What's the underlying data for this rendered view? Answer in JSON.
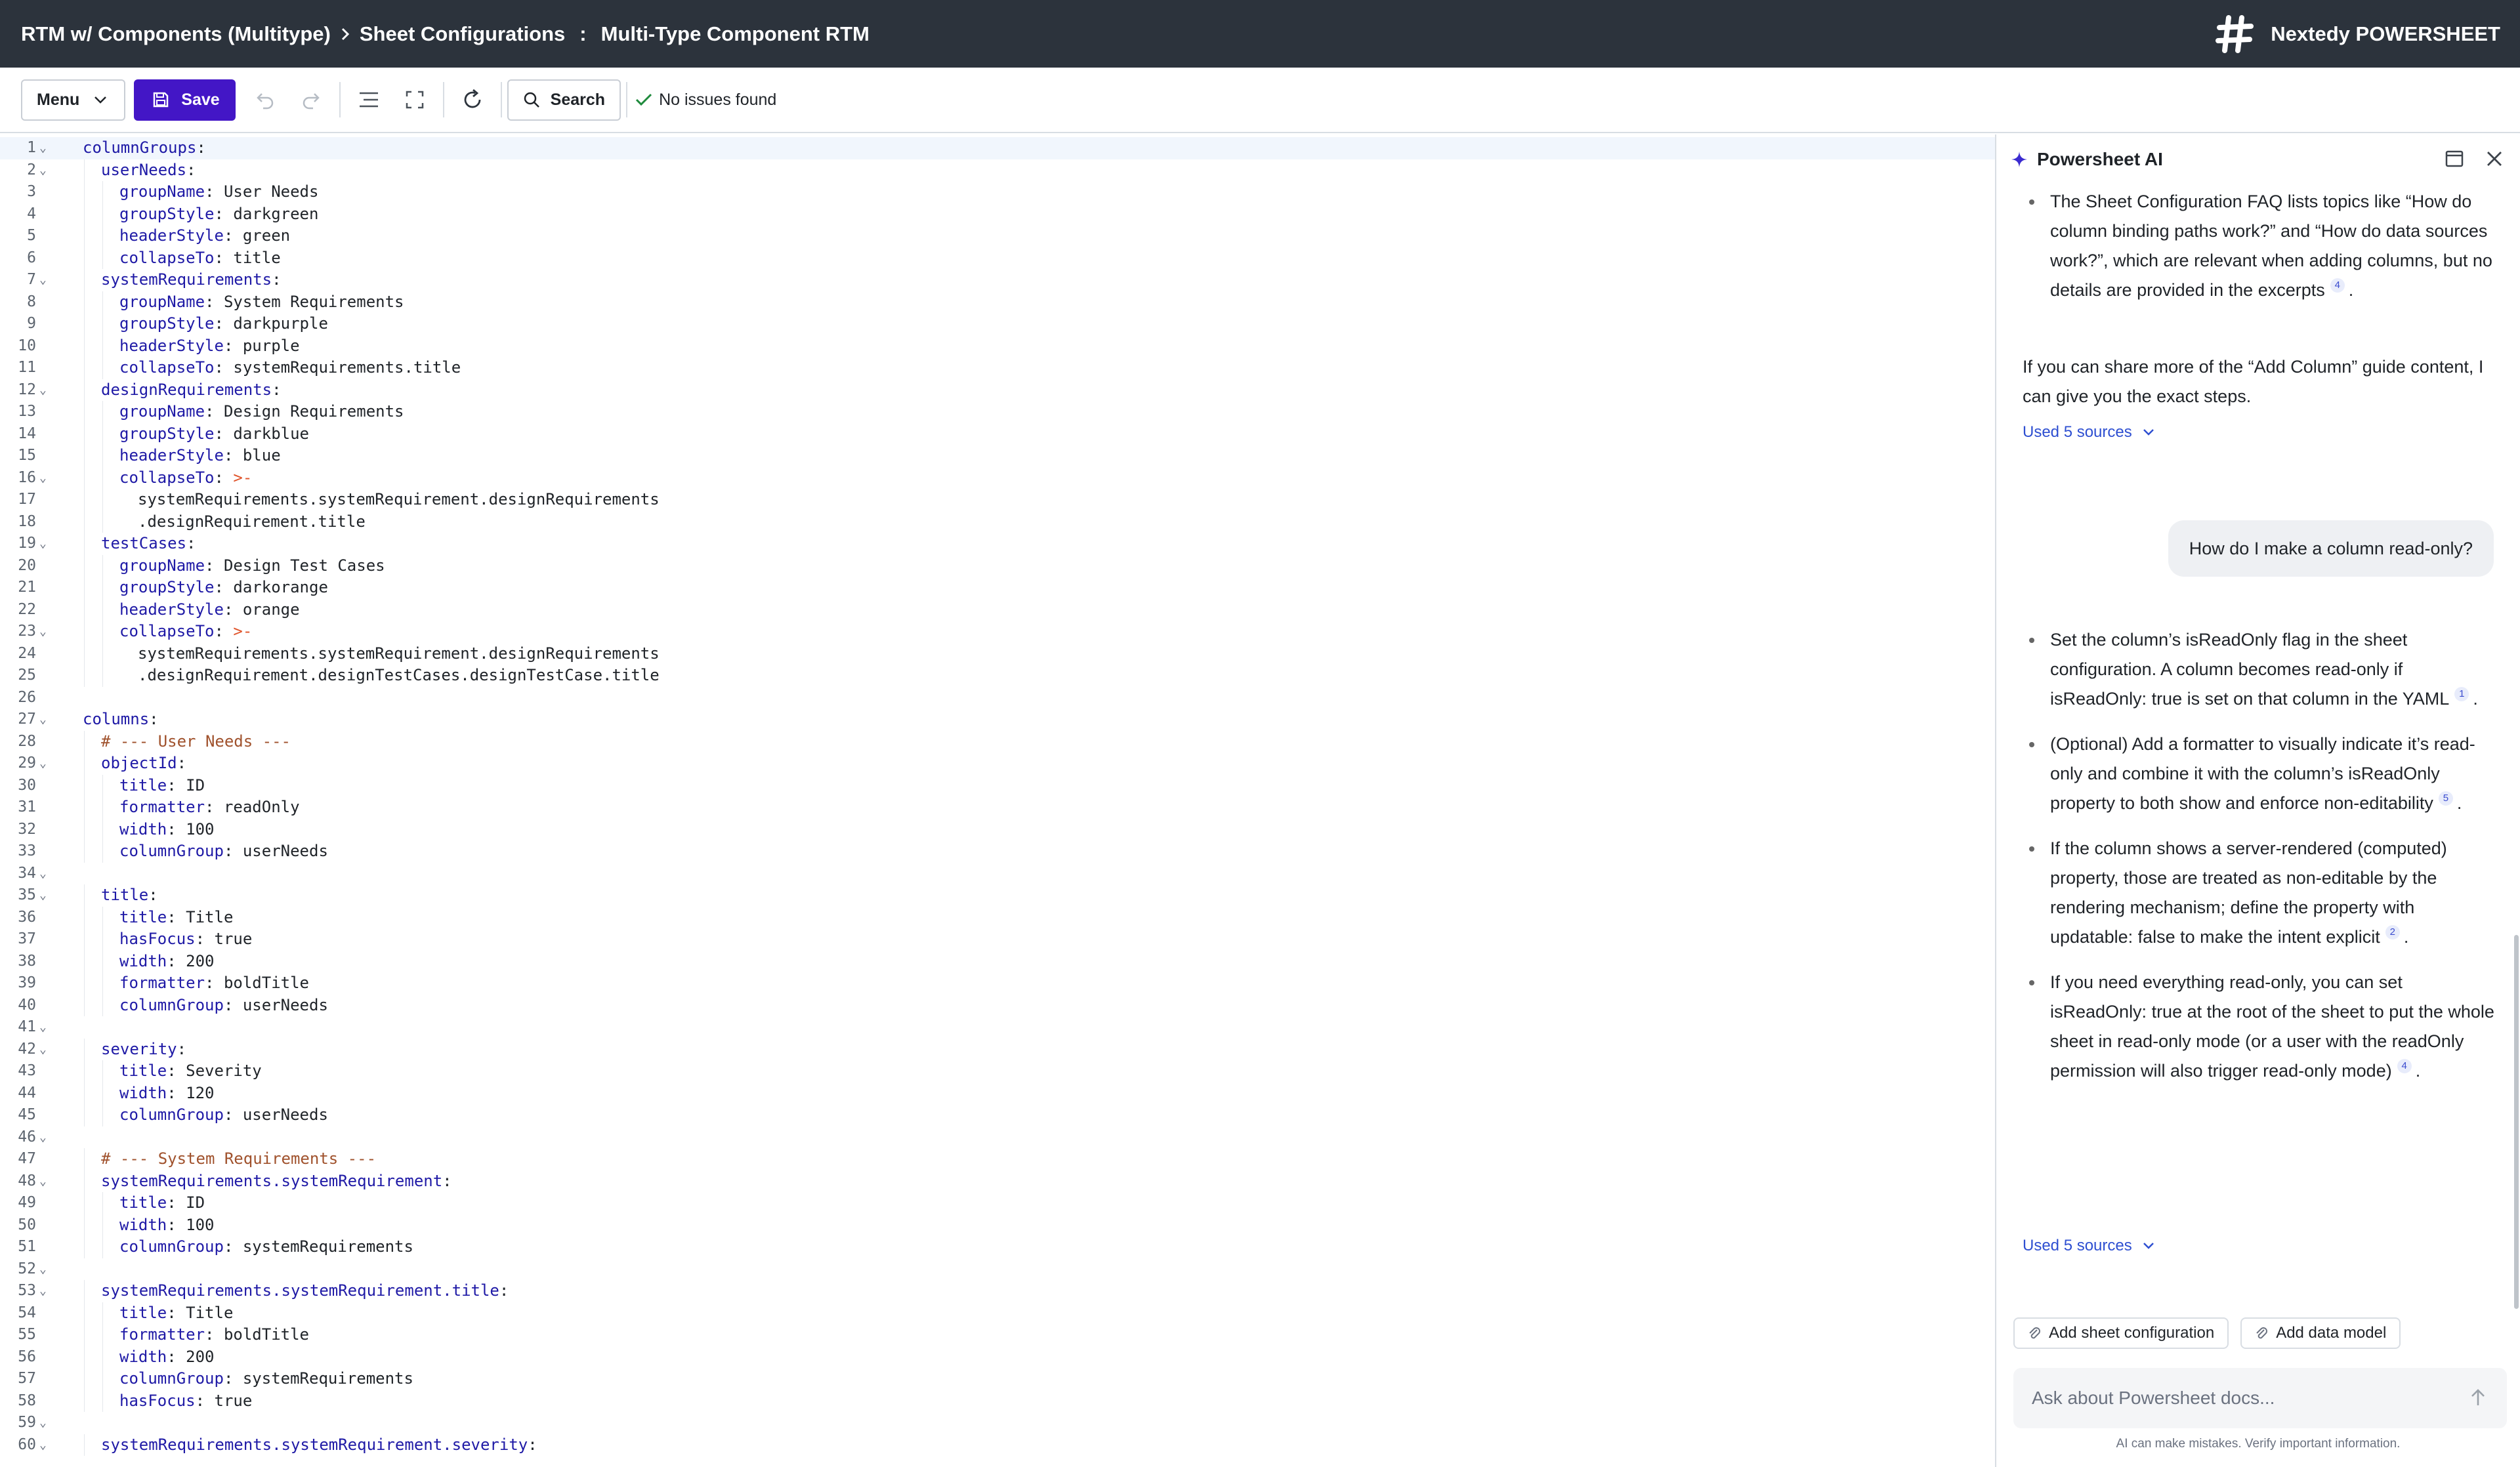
{
  "header": {
    "breadcrumb": [
      "RTM w/ Components (Multitype)",
      "Sheet Configurations"
    ],
    "document_title": "Multi-Type Component RTM",
    "brand": "Nextedy POWERSHEET"
  },
  "toolbar": {
    "menu_label": "Menu",
    "save_label": "Save",
    "search_label": "Search",
    "status_text": "No issues found"
  },
  "editor": {
    "lines": [
      {
        "n": "1",
        "fold": true,
        "indent": 0,
        "key": "columnGroups",
        "val": ""
      },
      {
        "n": "2",
        "fold": true,
        "indent": 1,
        "key": "userNeeds",
        "val": ""
      },
      {
        "n": "3",
        "fold": false,
        "indent": 2,
        "key": "groupName",
        "val": "User Needs"
      },
      {
        "n": "4",
        "fold": false,
        "indent": 2,
        "key": "groupStyle",
        "val": "darkgreen"
      },
      {
        "n": "5",
        "fold": false,
        "indent": 2,
        "key": "headerStyle",
        "val": "green"
      },
      {
        "n": "6",
        "fold": false,
        "indent": 2,
        "key": "collapseTo",
        "val": "title"
      },
      {
        "n": "7",
        "fold": true,
        "indent": 1,
        "key": "systemRequirements",
        "val": ""
      },
      {
        "n": "8",
        "fold": false,
        "indent": 2,
        "key": "groupName",
        "val": "System Requirements"
      },
      {
        "n": "9",
        "fold": false,
        "indent": 2,
        "key": "groupStyle",
        "val": "darkpurple"
      },
      {
        "n": "10",
        "fold": false,
        "indent": 2,
        "key": "headerStyle",
        "val": "purple"
      },
      {
        "n": "11",
        "fold": false,
        "indent": 2,
        "key": "collapseTo",
        "val": "systemRequirements.title"
      },
      {
        "n": "12",
        "fold": true,
        "indent": 1,
        "key": "designRequirements",
        "val": ""
      },
      {
        "n": "13",
        "fold": false,
        "indent": 2,
        "key": "groupName",
        "val": "Design Requirements"
      },
      {
        "n": "14",
        "fold": false,
        "indent": 2,
        "key": "groupStyle",
        "val": "darkblue"
      },
      {
        "n": "15",
        "fold": false,
        "indent": 2,
        "key": "headerStyle",
        "val": "blue"
      },
      {
        "n": "16",
        "fold": true,
        "indent": 2,
        "key": "collapseTo",
        "val": ">-",
        "op": true
      },
      {
        "n": "17",
        "fold": false,
        "indent": 3,
        "text": "systemRequirements.systemRequirement.designRequirements"
      },
      {
        "n": "18",
        "fold": false,
        "indent": 3,
        "text": ".designRequirement.title"
      },
      {
        "n": "19",
        "fold": true,
        "indent": 1,
        "key": "testCases",
        "val": ""
      },
      {
        "n": "20",
        "fold": false,
        "indent": 2,
        "key": "groupName",
        "val": "Design Test Cases"
      },
      {
        "n": "21",
        "fold": false,
        "indent": 2,
        "key": "groupStyle",
        "val": "darkorange"
      },
      {
        "n": "22",
        "fold": false,
        "indent": 2,
        "key": "headerStyle",
        "val": "orange"
      },
      {
        "n": "23",
        "fold": true,
        "indent": 2,
        "key": "collapseTo",
        "val": ">-",
        "op": true
      },
      {
        "n": "24",
        "fold": false,
        "indent": 3,
        "text": "systemRequirements.systemRequirement.designRequirements"
      },
      {
        "n": "25",
        "fold": false,
        "indent": 3,
        "text": ".designRequirement.designTestCases.designTestCase.title"
      },
      {
        "n": "26",
        "fold": false,
        "indent": 0,
        "text": ""
      },
      {
        "n": "27",
        "fold": true,
        "indent": 0,
        "key": "columns",
        "val": ""
      },
      {
        "n": "28",
        "fold": false,
        "indent": 1,
        "comment": "# --- User Needs ---"
      },
      {
        "n": "29",
        "fold": true,
        "indent": 1,
        "key": "objectId",
        "val": ""
      },
      {
        "n": "30",
        "fold": false,
        "indent": 2,
        "key": "title",
        "val": "ID"
      },
      {
        "n": "31",
        "fold": false,
        "indent": 2,
        "key": "formatter",
        "val": "readOnly"
      },
      {
        "n": "32",
        "fold": false,
        "indent": 2,
        "key": "width",
        "val": "100"
      },
      {
        "n": "33",
        "fold": false,
        "indent": 2,
        "key": "columnGroup",
        "val": "userNeeds"
      },
      {
        "n": "34",
        "fold": true,
        "indent": 0,
        "text": ""
      },
      {
        "n": "35",
        "fold": true,
        "indent": 1,
        "key": "title",
        "val": ""
      },
      {
        "n": "36",
        "fold": false,
        "indent": 2,
        "key": "title",
        "val": "Title"
      },
      {
        "n": "37",
        "fold": false,
        "indent": 2,
        "key": "hasFocus",
        "val": "true"
      },
      {
        "n": "38",
        "fold": false,
        "indent": 2,
        "key": "width",
        "val": "200"
      },
      {
        "n": "39",
        "fold": false,
        "indent": 2,
        "key": "formatter",
        "val": "boldTitle"
      },
      {
        "n": "40",
        "fold": false,
        "indent": 2,
        "key": "columnGroup",
        "val": "userNeeds"
      },
      {
        "n": "41",
        "fold": true,
        "indent": 0,
        "text": ""
      },
      {
        "n": "42",
        "fold": true,
        "indent": 1,
        "key": "severity",
        "val": ""
      },
      {
        "n": "43",
        "fold": false,
        "indent": 2,
        "key": "title",
        "val": "Severity"
      },
      {
        "n": "44",
        "fold": false,
        "indent": 2,
        "key": "width",
        "val": "120"
      },
      {
        "n": "45",
        "fold": false,
        "indent": 2,
        "key": "columnGroup",
        "val": "userNeeds"
      },
      {
        "n": "46",
        "fold": true,
        "indent": 0,
        "text": ""
      },
      {
        "n": "47",
        "fold": false,
        "indent": 1,
        "comment": "# --- System Requirements ---"
      },
      {
        "n": "48",
        "fold": true,
        "indent": 1,
        "key": "systemRequirements.systemRequirement",
        "val": ""
      },
      {
        "n": "49",
        "fold": false,
        "indent": 2,
        "key": "title",
        "val": "ID"
      },
      {
        "n": "50",
        "fold": false,
        "indent": 2,
        "key": "width",
        "val": "100"
      },
      {
        "n": "51",
        "fold": false,
        "indent": 2,
        "key": "columnGroup",
        "val": "systemRequirements"
      },
      {
        "n": "52",
        "fold": true,
        "indent": 0,
        "text": ""
      },
      {
        "n": "53",
        "fold": true,
        "indent": 1,
        "key": "systemRequirements.systemRequirement.title",
        "val": ""
      },
      {
        "n": "54",
        "fold": false,
        "indent": 2,
        "key": "title",
        "val": "Title"
      },
      {
        "n": "55",
        "fold": false,
        "indent": 2,
        "key": "formatter",
        "val": "boldTitle"
      },
      {
        "n": "56",
        "fold": false,
        "indent": 2,
        "key": "width",
        "val": "200"
      },
      {
        "n": "57",
        "fold": false,
        "indent": 2,
        "key": "columnGroup",
        "val": "systemRequirements"
      },
      {
        "n": "58",
        "fold": false,
        "indent": 2,
        "key": "hasFocus",
        "val": "true"
      },
      {
        "n": "59",
        "fold": true,
        "indent": 0,
        "text": ""
      },
      {
        "n": "60",
        "fold": true,
        "indent": 1,
        "key": "systemRequirements.systemRequirement.severity",
        "val": ""
      }
    ]
  },
  "assistant": {
    "title": "Powersheet AI",
    "answer1_bullet": "The Sheet Configuration FAQ lists topics like “How do column binding paths work?” and “How do data sources work?”, which are relevant when adding columns, but no details are provided in the excerpts",
    "answer1_bullet_cite": "4",
    "answer1_para": "If you can share more of the “Add Column” guide content, I can give you the exact steps.",
    "sources_label_1": "Used 5 sources",
    "user_question": "How do I make a column read-only?",
    "answer2_bullets": [
      {
        "text": "Set the column’s isReadOnly flag in the sheet configuration. A column becomes read-only if isReadOnly: true is set on that column in the YAML",
        "cite": "1"
      },
      {
        "text": "(Optional) Add a formatter to visually indicate it’s read-only and combine it with the column’s isReadOnly property to both show and enforce non-editability",
        "cite": "5"
      },
      {
        "text": "If the column shows a server-rendered (computed) property, those are treated as non-editable by the rendering mechanism; define the property with updatable: false to make the intent explicit",
        "cite": "2"
      },
      {
        "text": "If you need everything read-only, you can set isReadOnly: true at the root of the sheet to put the whole sheet in read-only mode (or a user with the readOnly permission will also trigger read-only mode)",
        "cite": "4"
      }
    ],
    "sources_label_2": "Used 5 sources",
    "chip_sheet_config": "Add sheet configuration",
    "chip_data_model": "Add data model",
    "input_placeholder": "Ask about Powersheet docs...",
    "disclaimer": "AI can make mistakes. Verify important information."
  }
}
